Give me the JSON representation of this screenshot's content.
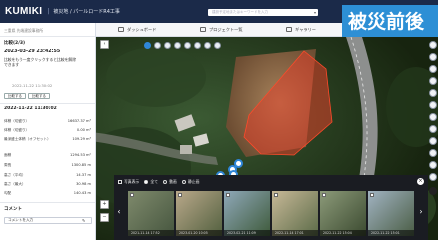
{
  "app": {
    "logo": "KUMIKI",
    "separator": "|",
    "project_title": "被災地 / パールロードR4工事",
    "search_placeholder": "建設予定地またはキーワードを入力"
  },
  "banner": {
    "text": "被災前後"
  },
  "panel": {
    "header_line": "三重県 先端建設事務所",
    "section_title": "比較(2/3)",
    "date_a": "2023-03-29 23:42:55",
    "note_lines": [
      "比較をもう一度クリックすると比較を解除",
      "できます"
    ],
    "date_b_sub": "2022-11-22 11:30:02",
    "btn_a": "比較する",
    "btn_b": "比較する",
    "dropdown_a": "2022-11-22 11:30:02",
    "stats": [
      {
        "label": "体積（切盛り）",
        "value": "16637.37 m³"
      },
      {
        "label": "体積（切盛り）",
        "value": "0.00 m³"
      },
      {
        "label": "最深盛土体積（オフセット）",
        "value": "109.29 m³"
      },
      {
        "label": "面積",
        "value": "1294.53 m²"
      },
      {
        "label": "周長",
        "value": "1300.85 m"
      },
      {
        "label": "高さ（平均）",
        "value": "14.37 m"
      },
      {
        "label": "高さ（最大）",
        "value": "30.98 m"
      },
      {
        "label": "勾配",
        "value": "140.43 m"
      }
    ],
    "comment_title": "コメント",
    "comment_placeholder": "コメントを入力"
  },
  "toolbar": {
    "items": [
      "ダッシュボード",
      "プロジェクト一覧",
      "ギャラリー"
    ]
  },
  "gallery": {
    "checkbox_label": "写真表示",
    "options": [
      "全て",
      "動画",
      "静止画"
    ],
    "thumbs": [
      {
        "caption": "2021-11-14 17:52"
      },
      {
        "caption": "2023-01-20 10:05"
      },
      {
        "caption": "2023-02-21 11:09"
      },
      {
        "caption": "2022-11-14 17:01"
      },
      {
        "caption": "2022-11-22 15:04"
      },
      {
        "caption": "2022-11-22 15:01"
      }
    ]
  },
  "colors": {
    "topbar": "#1b2a49",
    "accent": "#2f86d8",
    "polygon": "#e0402a"
  },
  "icons": {
    "layers": "layers-icon",
    "measure": "ruler-icon",
    "close": "close-icon",
    "edit": "pencil-icon"
  }
}
